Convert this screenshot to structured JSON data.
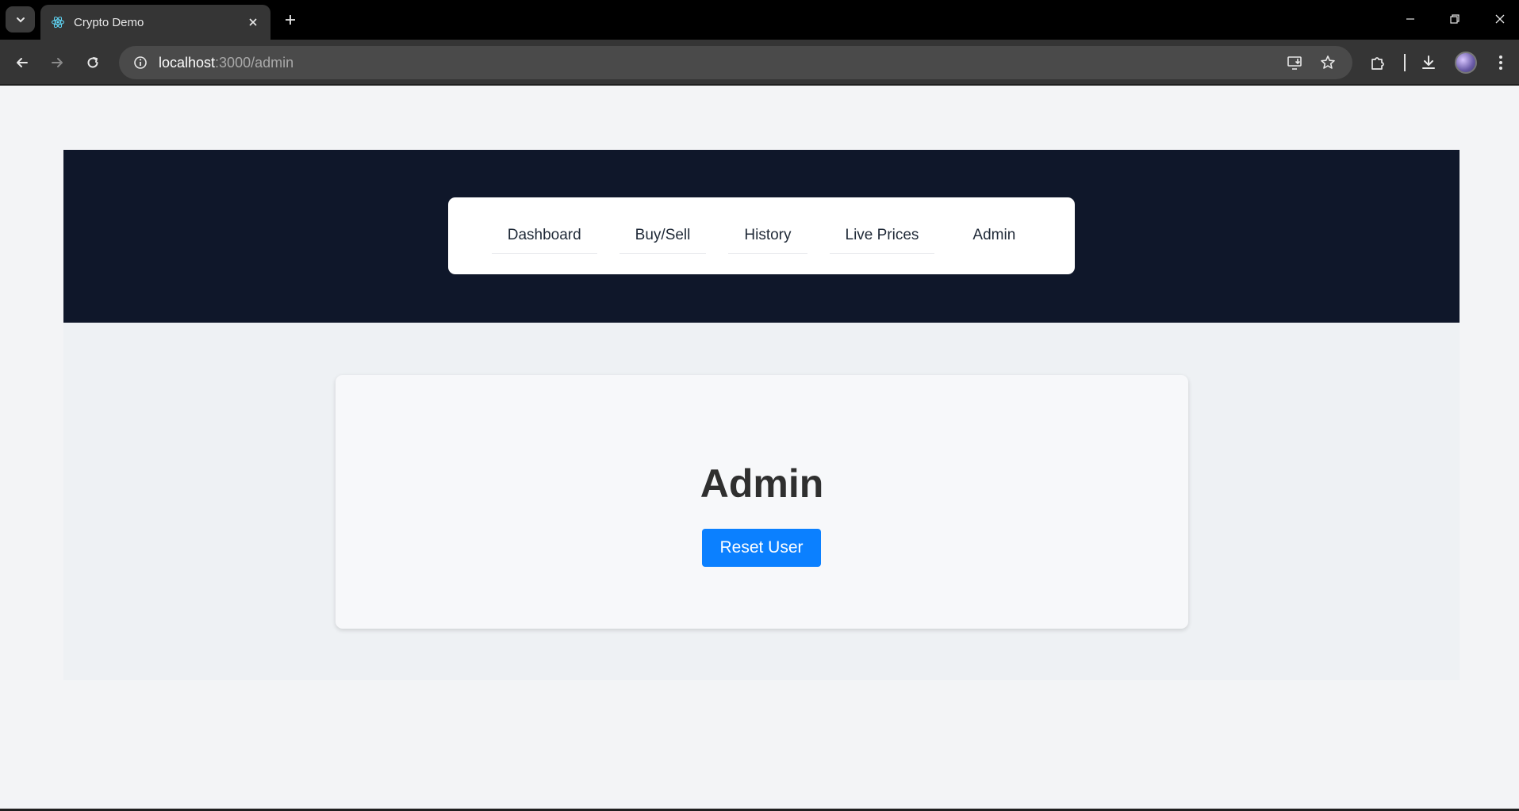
{
  "browser": {
    "tab": {
      "title": "Crypto Demo",
      "favicon": "react-icon"
    },
    "url": {
      "host": "localhost",
      "path": ":3000/admin"
    }
  },
  "nav": {
    "links": [
      {
        "label": "Dashboard"
      },
      {
        "label": "Buy/Sell"
      },
      {
        "label": "History"
      },
      {
        "label": "Live Prices"
      },
      {
        "label": "Admin"
      }
    ]
  },
  "main": {
    "title": "Admin",
    "reset_button_label": "Reset User"
  },
  "colors": {
    "header_bg": "#0f172a",
    "button_primary": "#0b80ff"
  }
}
